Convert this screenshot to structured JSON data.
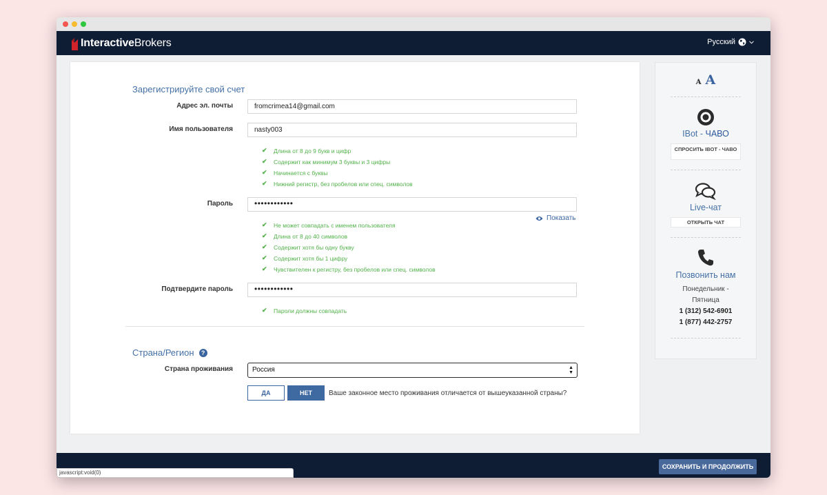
{
  "header": {
    "logo_bold": "Interactive",
    "logo_regular": "Brokers",
    "language": "Русский",
    "globe_icon": "globe-icon",
    "chevron_icon": "chevron-down-icon"
  },
  "form": {
    "title": "Зарегистрируйте свой счет",
    "email": {
      "label": "Адрес эл. почты",
      "value": "fromcrimea14@gmail.com"
    },
    "username": {
      "label": "Имя пользователя",
      "value": "nasty003",
      "rules": [
        "Длина от 8 до 9 букв и цифр",
        "Содержит как минимум 3 буквы и 3 цифры",
        "Начинается с буквы",
        "Нижний регистр, без пробелов или спец. символов"
      ]
    },
    "password": {
      "label": "Пароль",
      "value": "••••••••••••",
      "show_label": "Показать",
      "rules": [
        "Не может совпадать с именем пользователя",
        "Длина от 8 до 40 символов",
        "Содержит хотя бы одну букву",
        "Содержит хотя бы 1 цифру",
        "Чувствителен к регистру, без пробелов или спец. символов"
      ]
    },
    "confirm": {
      "label": "Подтвердите пароль",
      "value": "••••••••••••",
      "rules": [
        "Пароли должны совпадать"
      ]
    },
    "country_section": {
      "title": "Страна/Регион",
      "help_icon": "?",
      "residence_label": "Страна проживания",
      "residence_value": "Россия",
      "yes_label": "ДА",
      "no_label": "НЕТ",
      "question": "Ваше законное место проживания отличается от вышеуказанной страны?"
    }
  },
  "sidebar": {
    "font_small": "A",
    "font_large": "A",
    "ibot": {
      "title_prefix": "IBot - ",
      "title_suffix": "ЧАВО",
      "button": "СПРОСИТЬ IBOT - ЧАВО",
      "icon": "eye-icon"
    },
    "chat": {
      "title_prefix": "Live-",
      "title_suffix": "чат",
      "button": "ОТКРЫТЬ ЧАТ",
      "icon": "chat-bubbles-icon"
    },
    "call": {
      "title": "Позвонить нам",
      "hours_1": "Понедельник -",
      "hours_2": "Пятница",
      "phone_1": "1 (312) 542-6901",
      "phone_2": "1 (877) 442-2757",
      "icon": "phone-icon"
    }
  },
  "footer": {
    "save_button": "СОХРАНИТЬ И ПРОДОЛЖИТЬ"
  },
  "statusbar": {
    "text": "javascript:void(0)"
  },
  "colors": {
    "navy": "#0e1c34",
    "accent": "#3a64a0",
    "success": "#52b24a"
  }
}
